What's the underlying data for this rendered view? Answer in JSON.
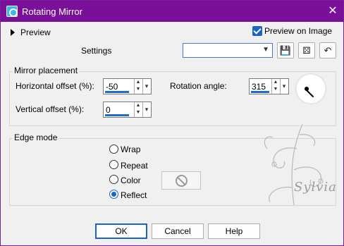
{
  "window": {
    "title": "Rotating Mirror",
    "close_glyph": "✕"
  },
  "topbar": {
    "preview_label": "Preview",
    "preview_on_image_label": "Preview on Image",
    "preview_on_image_checked": true,
    "settings_label": "Settings",
    "settings_value": "",
    "icons": [
      "save-icon",
      "dice-icon",
      "reset-icon"
    ]
  },
  "mirror_placement": {
    "title": "Mirror placement",
    "horizontal_label": "Horizontal offset (%):",
    "horizontal_value": "-50",
    "vertical_label": "Vertical offset (%):",
    "vertical_value": "0",
    "rotation_label": "Rotation angle:",
    "rotation_value": "315"
  },
  "edge_mode": {
    "title": "Edge mode",
    "options": [
      "Wrap",
      "Repeat",
      "Color",
      "Reflect"
    ],
    "selected": "Reflect"
  },
  "watermark": {
    "text": "Sylvia"
  },
  "buttons": {
    "ok": "OK",
    "cancel": "Cancel",
    "help": "Help"
  },
  "colors": {
    "titlebar": "#7a0f9a",
    "accent": "#1a65c4"
  }
}
